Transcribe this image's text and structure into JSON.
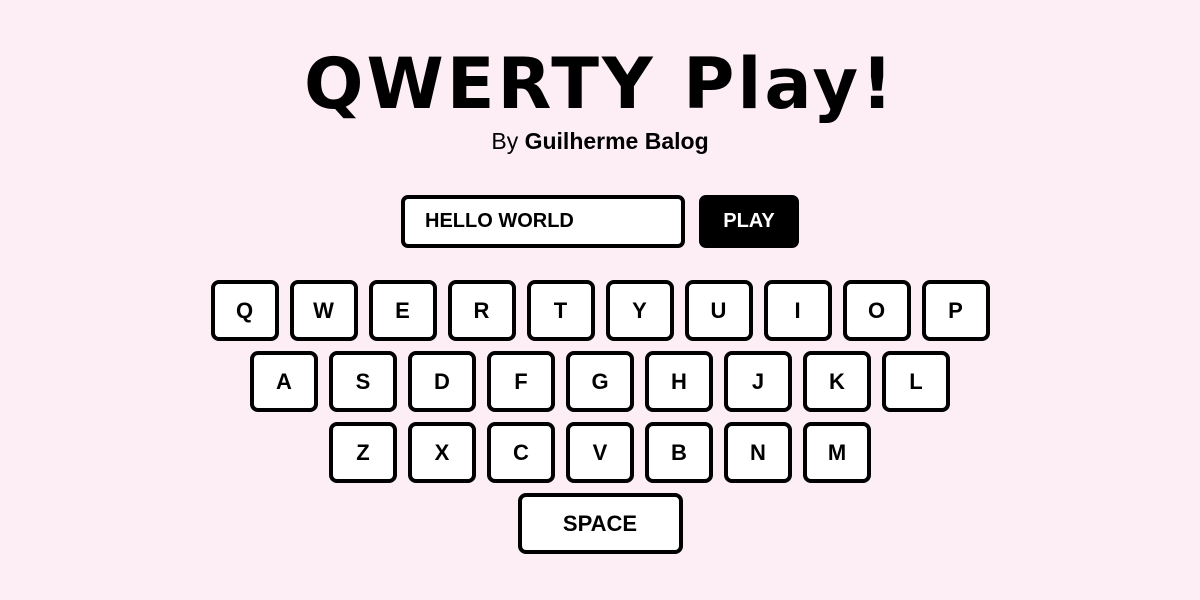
{
  "header": {
    "title": "QWERTY Play!",
    "byline_prefix": "By ",
    "author": "Guilherme Balog"
  },
  "controls": {
    "word_value": "HELLO WORLD",
    "play_label": "PLAY"
  },
  "keyboard": {
    "rows": [
      [
        "Q",
        "W",
        "E",
        "R",
        "T",
        "Y",
        "U",
        "I",
        "O",
        "P"
      ],
      [
        "A",
        "S",
        "D",
        "F",
        "G",
        "H",
        "J",
        "K",
        "L"
      ],
      [
        "Z",
        "X",
        "C",
        "V",
        "B",
        "N",
        "M"
      ]
    ],
    "space_label": "SPACE"
  },
  "colors": {
    "background": "#fdeef5",
    "key_fill": "#ffffff",
    "outline": "#000000",
    "button_fill": "#000000",
    "button_text": "#ffffff"
  }
}
